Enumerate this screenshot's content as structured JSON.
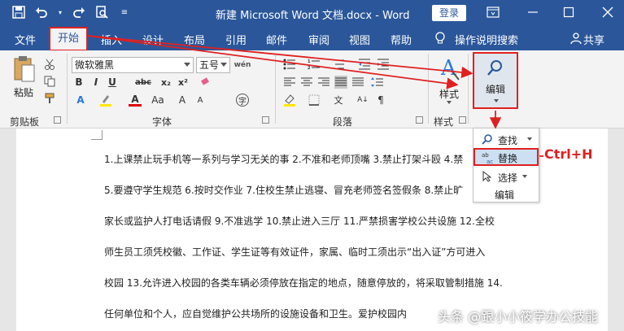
{
  "title_bar": {
    "title": "新建 Microsoft Word 文档.docx  -  Word",
    "login_label": "登录"
  },
  "tabs": [
    {
      "label": "文件"
    },
    {
      "label": "开始"
    },
    {
      "label": "插入"
    },
    {
      "label": "设计"
    },
    {
      "label": "布局"
    },
    {
      "label": "引用"
    },
    {
      "label": "邮件"
    },
    {
      "label": "审阅"
    },
    {
      "label": "视图"
    },
    {
      "label": "帮助"
    }
  ],
  "tell_me": "操作说明搜索",
  "share": "共享",
  "ribbon": {
    "clipboard_label": "剪贴板",
    "paste_label": "粘贴",
    "font_name": "微软雅黑",
    "font_size": "五号",
    "font_group_label": "字体",
    "paragraph_group_label": "段落",
    "styles_label": "样式",
    "styles_group_label": "样式",
    "edit_label": "编辑"
  },
  "dropdown": {
    "find": "查找",
    "replace": "替换",
    "select": "选择",
    "footer": "编辑"
  },
  "shortcut_note": "Ctrl+H",
  "document": {
    "lines": [
      "1.上课禁止玩手机等一系列与学习无关的事 2.不准和老师顶嘴 3.禁止打架斗殴 4.禁",
      "5.要遵守学生规范 6.按时交作业 7.住校生禁止逃寝、冒充老师签名签假条 8.禁止旷",
      "家长或监护人打电话请假 9.不准逃学 10.禁止进入三厅 11.严禁损害学校公共设施 12.全校",
      "师生员工须凭校徽、工作证、学生证等有效证件，家属、临时工须出示“出入证”方可进入",
      "校园 13.允许进入校园的各类车辆必须停放在指定的地点，随意停放的，将采取管制措施 14.",
      "任何单位和个人，应自觉维护公共场所的设施设备和卫生。爱护校园内"
    ]
  },
  "watermark": "头条 @跟小小筱学办公技能",
  "colors": {
    "brand_blue": "#2b579a",
    "highlight_red": "#e02020"
  }
}
